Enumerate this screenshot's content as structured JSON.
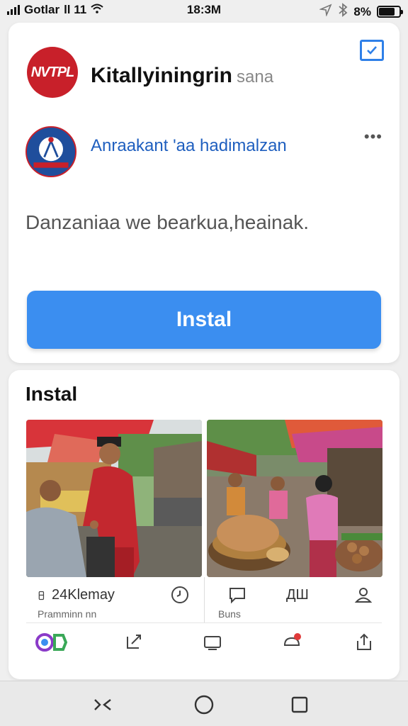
{
  "status_bar": {
    "carrier": "Gotlar",
    "network": "ll 11",
    "time": "18:3M",
    "battery": "8%",
    "battery_level": 0.8
  },
  "app_header": {
    "logo_text": "NVTPL",
    "title": "Kitallyiningrin",
    "title_suffix": "sana",
    "publisher": "Anraakant 'aa hadimalzan",
    "description": "Danzaniaa we bearkua,heainak.",
    "install_label": "Instal"
  },
  "gallery": {
    "section_title": "Instal",
    "left": {
      "stat": "24Klemay",
      "sub": "Pramminn nn"
    },
    "right": {
      "stat": "ДШ",
      "sub": "Buns"
    }
  },
  "colors": {
    "accent": "#3b8ef0",
    "brand_red": "#c8202a",
    "publisher_blue": "#1f5fbf"
  },
  "icons": {
    "top_right": "checkbox-icon",
    "more": "more-dots-icon",
    "clock": "clock-icon",
    "comment": "comment-icon",
    "person": "person-icon"
  }
}
